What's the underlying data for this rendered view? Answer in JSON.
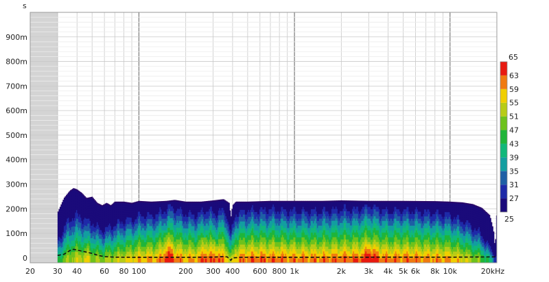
{
  "chart_data": {
    "type": "heatmap",
    "title": "",
    "ylabel": "s",
    "xlabel": "",
    "x_unit_suffix": "kHz",
    "x_scale": "log",
    "xlim": [
      20,
      20000
    ],
    "ylim": [
      -0.02,
      1.0
    ],
    "grid": true,
    "excluded_x_range": [
      20,
      30
    ],
    "x_ticks": [
      {
        "value": 20,
        "label": "20"
      },
      {
        "value": 30,
        "label": "30"
      },
      {
        "value": 40,
        "label": "40"
      },
      {
        "value": 60,
        "label": "60"
      },
      {
        "value": 80,
        "label": "80"
      },
      {
        "value": 100,
        "label": "100"
      },
      {
        "value": 200,
        "label": "200"
      },
      {
        "value": 300,
        "label": "300"
      },
      {
        "value": 400,
        "label": "400"
      },
      {
        "value": 600,
        "label": "600"
      },
      {
        "value": 800,
        "label": "800"
      },
      {
        "value": 1000,
        "label": "1k"
      },
      {
        "value": 2000,
        "label": "2k"
      },
      {
        "value": 3000,
        "label": "3k"
      },
      {
        "value": 4000,
        "label": "4k"
      },
      {
        "value": 5000,
        "label": "5k"
      },
      {
        "value": 6000,
        "label": "6k"
      },
      {
        "value": 8000,
        "label": "8k"
      },
      {
        "value": 10000,
        "label": "10k"
      },
      {
        "value": 20000,
        "label": "20kHz"
      }
    ],
    "y_ticks": [
      {
        "value": 0,
        "label": "0"
      },
      {
        "value": 0.1,
        "label": "100m"
      },
      {
        "value": 0.2,
        "label": "200m"
      },
      {
        "value": 0.3,
        "label": "300m"
      },
      {
        "value": 0.4,
        "label": "400m"
      },
      {
        "value": 0.5,
        "label": "500m"
      },
      {
        "value": 0.6,
        "label": "600m"
      },
      {
        "value": 0.7,
        "label": "700m"
      },
      {
        "value": 0.8,
        "label": "800m"
      },
      {
        "value": 0.9,
        "label": "900m"
      }
    ],
    "envelope_top": [
      [
        30,
        0.18
      ],
      [
        33,
        0.24
      ],
      [
        36,
        0.27
      ],
      [
        38,
        0.28
      ],
      [
        40,
        0.275
      ],
      [
        43,
        0.26
      ],
      [
        46,
        0.24
      ],
      [
        50,
        0.245
      ],
      [
        54,
        0.22
      ],
      [
        58,
        0.21
      ],
      [
        62,
        0.22
      ],
      [
        66,
        0.21
      ],
      [
        70,
        0.225
      ],
      [
        80,
        0.225
      ],
      [
        90,
        0.22
      ],
      [
        100,
        0.228
      ],
      [
        120,
        0.225
      ],
      [
        150,
        0.228
      ],
      [
        170,
        0.232
      ],
      [
        200,
        0.225
      ],
      [
        250,
        0.225
      ],
      [
        300,
        0.23
      ],
      [
        350,
        0.235
      ],
      [
        380,
        0.22
      ],
      [
        390,
        0.16
      ],
      [
        400,
        0.21
      ],
      [
        420,
        0.225
      ],
      [
        500,
        0.225
      ],
      [
        700,
        0.228
      ],
      [
        1000,
        0.228
      ],
      [
        1500,
        0.228
      ],
      [
        2000,
        0.23
      ],
      [
        3000,
        0.228
      ],
      [
        5000,
        0.228
      ],
      [
        8000,
        0.227
      ],
      [
        10000,
        0.225
      ],
      [
        12000,
        0.222
      ],
      [
        14000,
        0.215
      ],
      [
        16000,
        0.2
      ],
      [
        18000,
        0.17
      ],
      [
        19000,
        0.11
      ],
      [
        19500,
        0.03
      ],
      [
        20000,
        0.19
      ]
    ],
    "color_scale": {
      "min": 25,
      "max": 65,
      "min_label": "25",
      "max_label": "65",
      "tick_labels": [
        "63",
        "59",
        "55",
        "51",
        "47",
        "43",
        "39",
        "35",
        "31",
        "27"
      ],
      "bands": [
        {
          "from": 25,
          "to": 29,
          "color": "#1a0a7a"
        },
        {
          "from": 29,
          "to": 33,
          "color": "#1e2aa8"
        },
        {
          "from": 33,
          "to": 37,
          "color": "#1f5fa5"
        },
        {
          "from": 37,
          "to": 41,
          "color": "#139ea0"
        },
        {
          "from": 41,
          "to": 45,
          "color": "#10b87a"
        },
        {
          "from": 45,
          "to": 49,
          "color": "#1fb53a"
        },
        {
          "from": 49,
          "to": 53,
          "color": "#6ec21c"
        },
        {
          "from": 53,
          "to": 57,
          "color": "#b8cc16"
        },
        {
          "from": 57,
          "to": 61,
          "color": "#f0cf00"
        },
        {
          "from": 61,
          "to": 65,
          "color": "#f07a10"
        },
        {
          "from": 65,
          "to": 69,
          "color": "#e81a10"
        }
      ]
    },
    "level_profile": [
      [
        30,
        46
      ],
      [
        34,
        52
      ],
      [
        38,
        55
      ],
      [
        44,
        56
      ],
      [
        50,
        54
      ],
      [
        60,
        52
      ],
      [
        70,
        55
      ],
      [
        80,
        57
      ],
      [
        100,
        60
      ],
      [
        130,
        61
      ],
      [
        160,
        66
      ],
      [
        190,
        62
      ],
      [
        230,
        61
      ],
      [
        270,
        64
      ],
      [
        310,
        62
      ],
      [
        360,
        63
      ],
      [
        390,
        52
      ],
      [
        420,
        62
      ],
      [
        500,
        64
      ],
      [
        700,
        64
      ],
      [
        1000,
        63
      ],
      [
        1500,
        63
      ],
      [
        2000,
        64
      ],
      [
        2500,
        64
      ],
      [
        3000,
        67
      ],
      [
        4000,
        63
      ],
      [
        5000,
        64
      ],
      [
        6000,
        63
      ],
      [
        8000,
        62
      ],
      [
        10000,
        61
      ],
      [
        13000,
        56
      ],
      [
        16000,
        50
      ],
      [
        19000,
        38
      ],
      [
        20000,
        30
      ]
    ],
    "modal_peaks": [
      [
        47,
        0.06,
        30
      ],
      [
        62,
        0.05,
        18
      ],
      [
        150,
        0.1,
        45
      ],
      [
        160,
        0.06,
        30
      ],
      [
        265,
        0.08,
        40
      ],
      [
        305,
        0.08,
        35
      ],
      [
        320,
        0.05,
        25
      ],
      [
        3000,
        0.06,
        35
      ],
      [
        3200,
        0.04,
        20
      ]
    ],
    "dashed_line": [
      [
        30,
        0.01
      ],
      [
        33,
        0.015
      ],
      [
        36,
        0.03
      ],
      [
        38,
        0.035
      ],
      [
        40,
        0.032
      ],
      [
        45,
        0.025
      ],
      [
        50,
        0.018
      ],
      [
        55,
        0.01
      ],
      [
        60,
        0.005
      ],
      [
        70,
        0.003
      ],
      [
        100,
        0.002
      ],
      [
        200,
        0.002
      ],
      [
        300,
        0.003
      ],
      [
        340,
        0.005
      ],
      [
        370,
        0.004
      ],
      [
        390,
        -0.01
      ],
      [
        400,
        0.0
      ],
      [
        450,
        0.002
      ],
      [
        1000,
        0.002
      ],
      [
        5000,
        0.003
      ],
      [
        10000,
        0.003
      ],
      [
        20000,
        0.004
      ]
    ]
  }
}
